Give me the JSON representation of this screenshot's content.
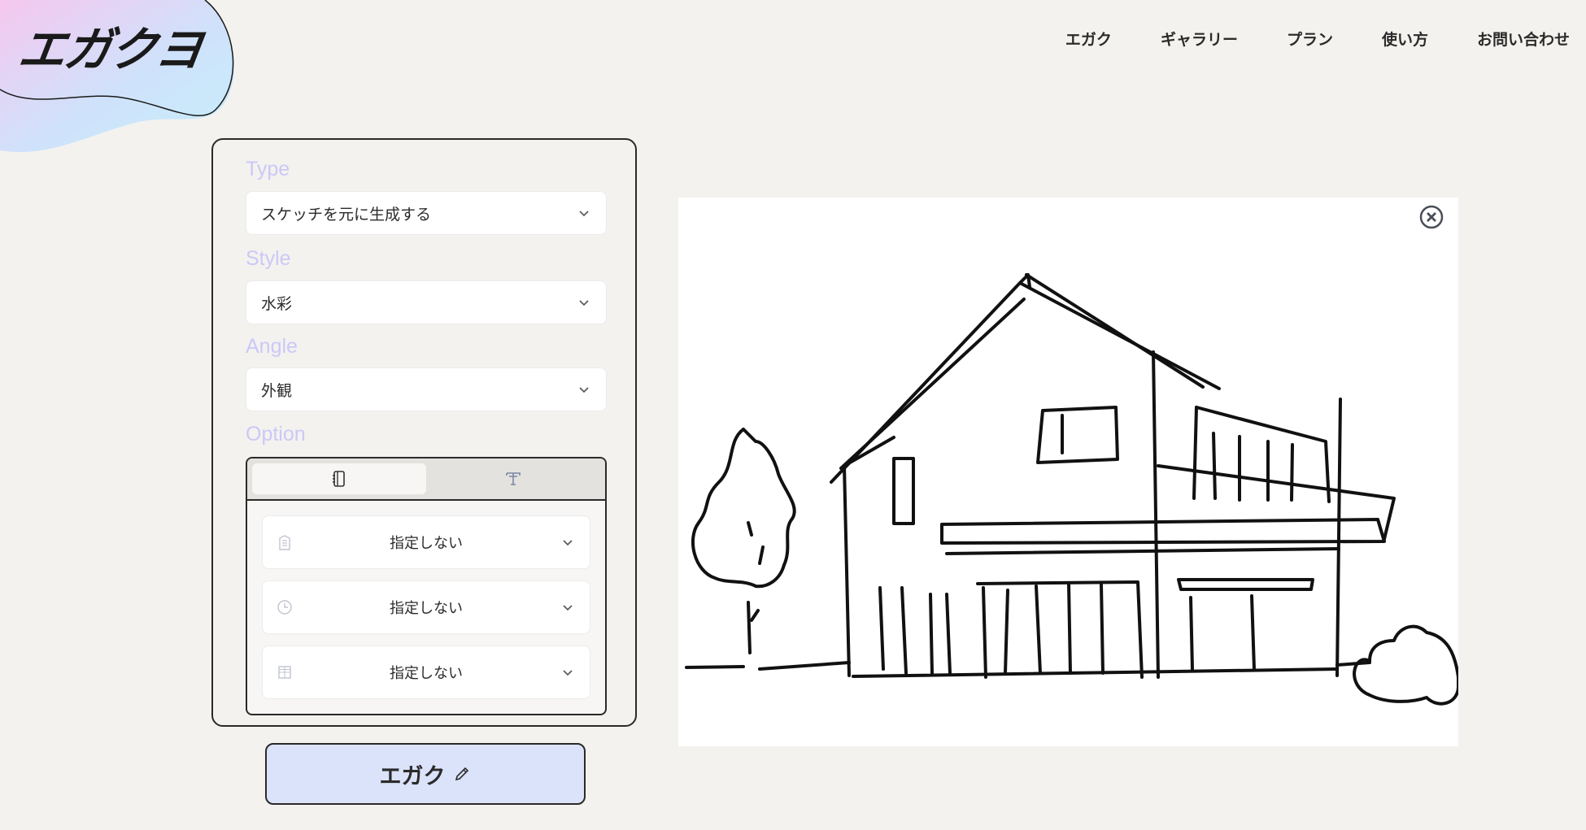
{
  "logo": {
    "text": "エガクヨ"
  },
  "nav": {
    "items": [
      "エガク",
      "ギャラリー",
      "プラン",
      "使い方",
      "お問い合わせ"
    ]
  },
  "form": {
    "type": {
      "label": "Type",
      "value": "スケッチを元に生成する"
    },
    "style": {
      "label": "Style",
      "value": "水彩"
    },
    "angle": {
      "label": "Angle",
      "value": "外観"
    },
    "option": {
      "label": "Option",
      "tabs": [
        {
          "icon": "notebook-icon",
          "active": true
        },
        {
          "icon": "text-format-icon",
          "active": false
        }
      ],
      "rows": [
        {
          "icon": "building-icon",
          "value": "指定しない"
        },
        {
          "icon": "clock-icon",
          "value": "指定しない"
        },
        {
          "icon": "window-icon",
          "value": "指定しない"
        }
      ]
    }
  },
  "generate_button": {
    "label": "エガク",
    "icon": "pencil-icon"
  },
  "canvas": {
    "content": "house-sketch",
    "close_icon": "close-circle-icon"
  },
  "colors": {
    "background": "#f3f2ef",
    "label": "#cbc8f6",
    "button": "#dbe3fb",
    "border": "#2a2a2a"
  }
}
